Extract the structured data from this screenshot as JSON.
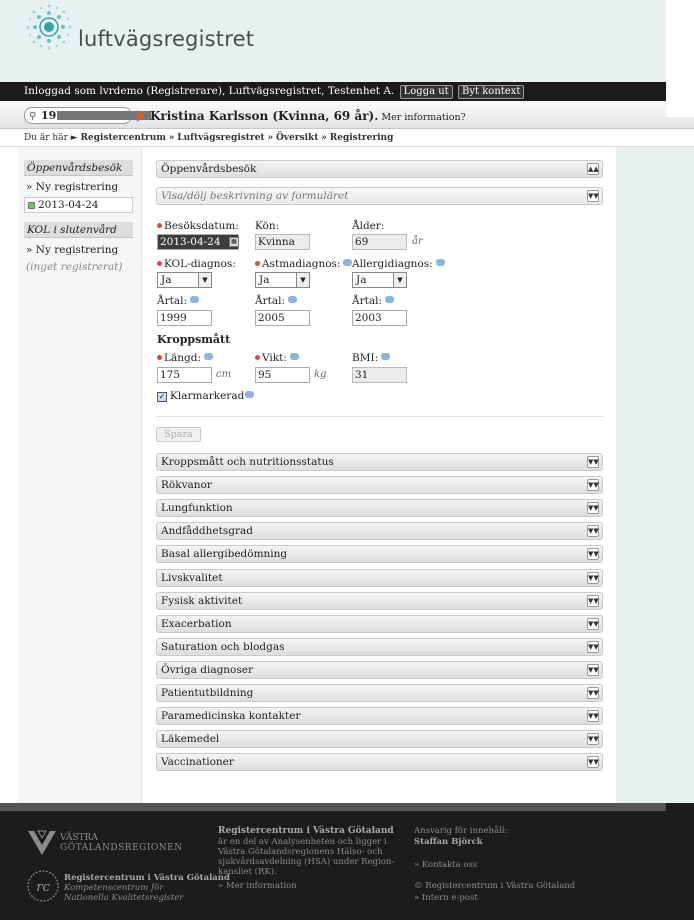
{
  "header": {
    "logo_text": "luftvägsregistret"
  },
  "login": {
    "text": "Inloggad som lvrdemo (Registrerare), Luftvägsregistret, Testenhet A.",
    "logout": "Logga ut",
    "switch": "Byt kontext"
  },
  "patient": {
    "search_value": "19",
    "name": "Kristina Karlsson (Kvinna, 69 år).",
    "more": "Mer information?"
  },
  "breadcrumb": {
    "prefix": "Du är här ►",
    "items": [
      "Registercentrum",
      "Luftvägsregistret",
      "Översikt",
      "Registrering"
    ],
    "sep": "»"
  },
  "sidebar": {
    "groups": [
      {
        "title": "Öppenvårdsbesök",
        "new": "» Ny registrering",
        "entry": "2013-04-24"
      },
      {
        "title": "KOL i slutenvård",
        "new": "» Ny registrering",
        "empty": "(inget registrerat)"
      }
    ]
  },
  "form": {
    "section_title": "Öppenvårdsbesök",
    "desc_toggle": "Visa/dölj beskrivning av formuläret",
    "besoksdatum": {
      "label": "Besöksdatum:",
      "value": "2013-04-24"
    },
    "kon": {
      "label": "Kön:",
      "value": "Kvinna"
    },
    "alder": {
      "label": "Ålder:",
      "value": "69",
      "unit": "år"
    },
    "kol": {
      "label": "KOL-diagnos:",
      "value": "Ja"
    },
    "astma": {
      "label": "Astmadiagnos:",
      "value": "Ja"
    },
    "allergi": {
      "label": "Allergidiagnos:",
      "value": "Ja"
    },
    "artal_label": "Årtal:",
    "artal_kol": "1999",
    "artal_astma": "2005",
    "artal_allergi": "2003",
    "kroppsmatt_title": "Kroppsmått",
    "langd": {
      "label": "Längd:",
      "value": "175",
      "unit": "cm"
    },
    "vikt": {
      "label": "Vikt:",
      "value": "95",
      "unit": "kg"
    },
    "bmi": {
      "label": "BMI:",
      "value": "31"
    },
    "klarmarkerad": "Klarmarkerad",
    "save": "Spara"
  },
  "sections": [
    "Kroppsmått och nutritionsstatus",
    "Rökvanor",
    "Lungfunktion",
    "Andfåddhetsgrad",
    "Basal allergibedömning",
    "Livskvalitet",
    "Fysisk aktivitet",
    "Exacerbation",
    "Saturation och blodgas",
    "Övriga diagnoser",
    "Patientutbildning",
    "Paramedicinska kontakter",
    "Läkemedel",
    "Vaccinationer"
  ],
  "footer": {
    "vgr_line1": "VÄSTRA",
    "vgr_line2": "GÖTALANDSREGIONEN",
    "rc_line1": "Registercentrum i Västra Götaland",
    "rc_line2": "Kompetenscentrum för",
    "rc_line3": "Nationella Kvalitetsregister",
    "col2_title": "Registercentrum i Västra Götaland",
    "col2_lines": [
      "är en del av Analysenheten och ligger i",
      "Västra Götalandsregionens Hälso- och",
      "sjukvårdsavdelning (HSA) under Region-",
      "kansliet (RK)."
    ],
    "col2_link": "» Mer information",
    "col3_label": "Ansvarig för innehåll:",
    "col3_name": "Staffan Björck",
    "col3_contact": "» Kontakta oss",
    "col3_copy": "© Registercentrum i Västra Götaland",
    "col3_email": "» Intern e-post"
  },
  "colors": {
    "accent": "#e25b2f",
    "header_bg": "#e6f1f0",
    "dark_bar": "#1b1b1b"
  }
}
